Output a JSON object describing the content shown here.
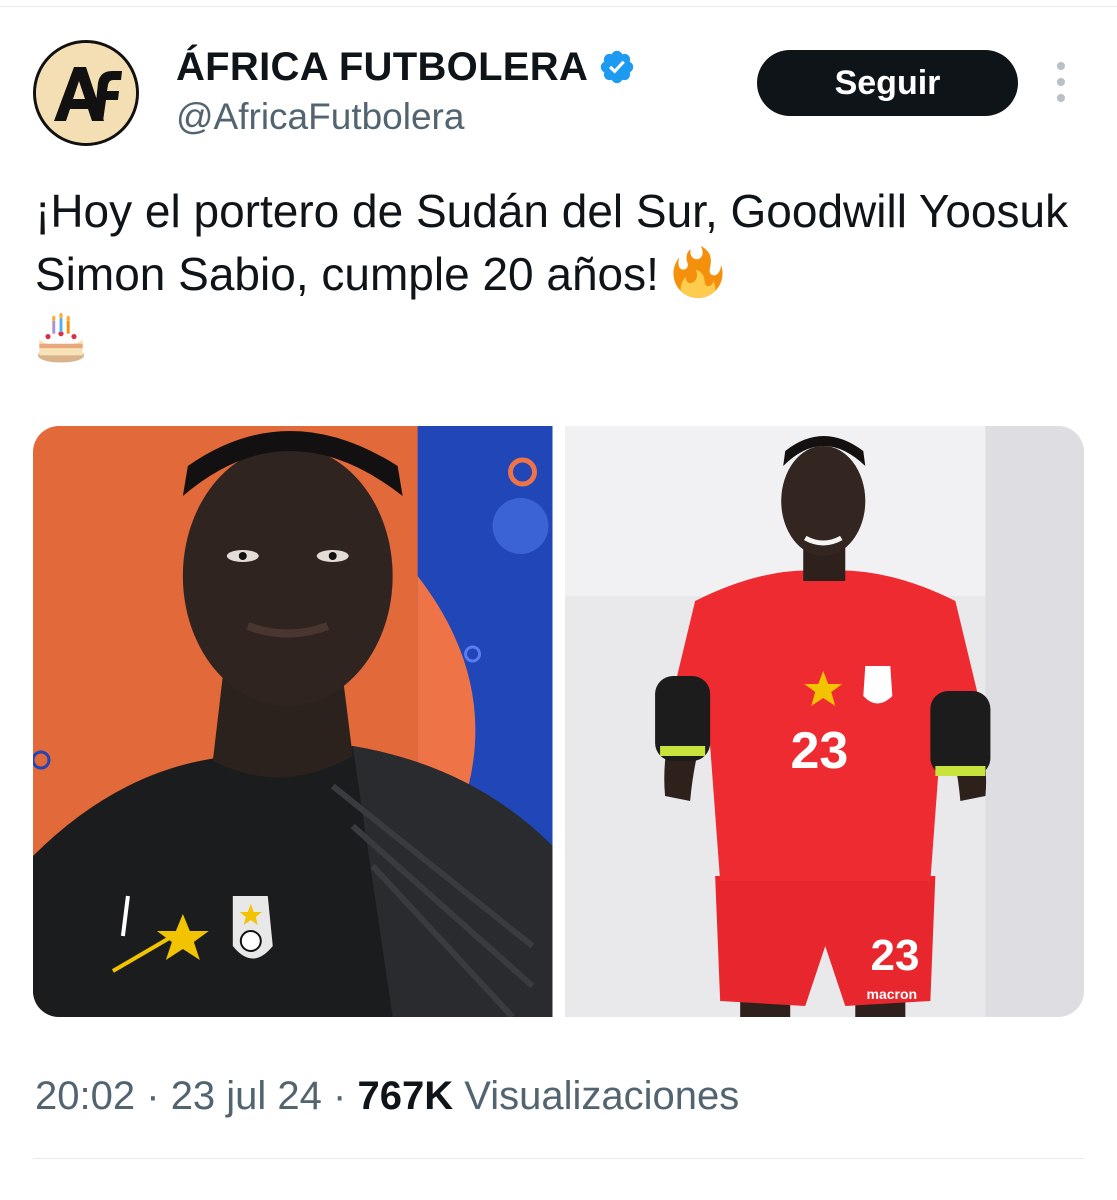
{
  "author": {
    "display_name": "ÁFRICA FUTBOLERA",
    "handle": "@AfricaFutbolera",
    "avatar_text": "Af",
    "verified": true
  },
  "actions": {
    "follow_label": "Seguir",
    "more_icon": "more-vertical-icon"
  },
  "tweet": {
    "text": "¡Hoy el portero de Sudán del Sur, Goodwill Yoosuk Simon Sabio, cumple 20 años!",
    "emojis": [
      "fire-icon",
      "birthday-cake-icon"
    ]
  },
  "media": {
    "photos": [
      {
        "subject": "goalkeeper-black-kit-photo",
        "shirt_number": ""
      },
      {
        "subject": "goalkeeper-red-kit-photo",
        "shirt_number": "23",
        "shorts_number": "23",
        "shorts_brand": "macron"
      }
    ]
  },
  "footer": {
    "time": "20:02",
    "separator": "·",
    "date": "23 jul 24",
    "views_count": "767K",
    "views_label": "Visualizaciones"
  },
  "colors": {
    "text_primary": "#0f1419",
    "text_secondary": "#536471",
    "verified_blue": "#1d9bf0",
    "follow_bg": "#0f1419",
    "divider": "#e7e9ea"
  }
}
